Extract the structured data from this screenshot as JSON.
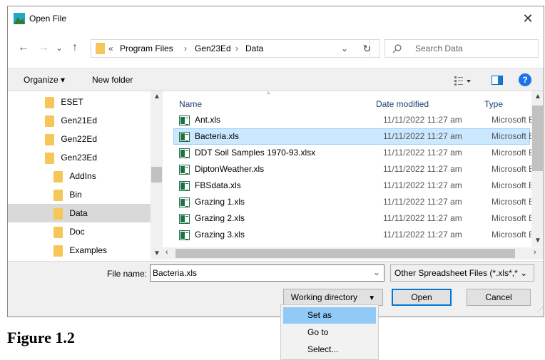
{
  "window": {
    "title": "Open File",
    "close_glyph": "✕"
  },
  "nav": {
    "back": "←",
    "forward": "→",
    "recent": "⌄",
    "up": "↑",
    "breadcrumb": [
      "«",
      "Program Files",
      "›",
      "Gen23Ed",
      "›",
      "Data"
    ],
    "address_dropdown": "⌄",
    "refresh": "↻",
    "search_placeholder": "Search Data"
  },
  "toolbar": {
    "organize": "Organize ▾",
    "new_folder": "New folder",
    "help": "?"
  },
  "tree": [
    {
      "label": "ESET",
      "indent": 0
    },
    {
      "label": "Gen21Ed",
      "indent": 0
    },
    {
      "label": "Gen22Ed",
      "indent": 0
    },
    {
      "label": "Gen23Ed",
      "indent": 0
    },
    {
      "label": "AddIns",
      "indent": 1
    },
    {
      "label": "Bin",
      "indent": 1
    },
    {
      "label": "Data",
      "indent": 1,
      "selected": true
    },
    {
      "label": "Doc",
      "indent": 1
    },
    {
      "label": "Examples",
      "indent": 1
    }
  ],
  "columns": {
    "name": "Name",
    "date": "Date modified",
    "type": "Type"
  },
  "files": [
    {
      "name": "Ant.xls",
      "date": "11/11/2022 11:27 am",
      "type": "Microsoft Ex"
    },
    {
      "name": "Bacteria.xls",
      "date": "11/11/2022 11:27 am",
      "type": "Microsoft Ex",
      "selected": true
    },
    {
      "name": "DDT Soil Samples 1970-93.xlsx",
      "date": "11/11/2022 11:27 am",
      "type": "Microsoft Ex"
    },
    {
      "name": "DiptonWeather.xls",
      "date": "11/11/2022 11:27 am",
      "type": "Microsoft Ex"
    },
    {
      "name": "FBSdata.xls",
      "date": "11/11/2022 11:27 am",
      "type": "Microsoft Ex"
    },
    {
      "name": "Grazing 1.xls",
      "date": "11/11/2022 11:27 am",
      "type": "Microsoft Ex"
    },
    {
      "name": "Grazing 2.xls",
      "date": "11/11/2022 11:27 am",
      "type": "Microsoft Ex"
    },
    {
      "name": "Grazing 3.xls",
      "date": "11/11/2022 11:27 am",
      "type": "Microsoft Ex"
    }
  ],
  "footer": {
    "file_name_label": "File name:",
    "file_name_value": "Bacteria.xls",
    "file_type": "Other Spreadsheet Files (*.xls*,* ⌄",
    "working_directory": "Working directory",
    "open": "Open",
    "cancel": "Cancel"
  },
  "menu": [
    "Set as",
    "Go to",
    "Select..."
  ],
  "caption": "Figure 1.2",
  "colors": {
    "selection": "#cce8ff",
    "selection_border": "#99d1ff",
    "menu_highlight": "#91c9f7",
    "folder": "#f6c758",
    "excel": "#1e7145",
    "help": "#1a73e8"
  }
}
